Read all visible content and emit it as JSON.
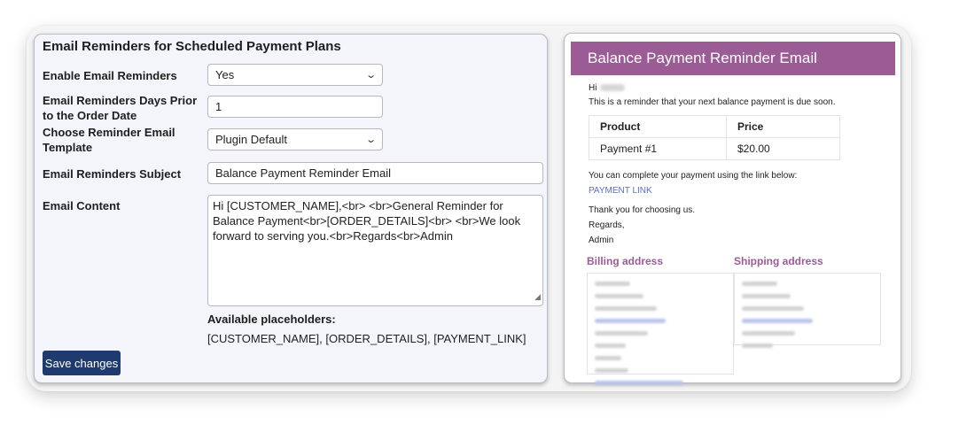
{
  "settings": {
    "title": "Email Reminders for Scheduled Payment Plans",
    "fields": [
      {
        "label": "Enable Email Reminders",
        "value": "Yes"
      },
      {
        "label": "Email Reminders Days Prior to the Order Date",
        "value": "1"
      },
      {
        "label": "Choose Reminder Email Template",
        "value": "Plugin Default"
      },
      {
        "label": "Email Reminders Subject",
        "value": "Balance Payment Reminder Email"
      },
      {
        "label": "Email Content",
        "value": "Hi [CUSTOMER_NAME],<br> <br>General Reminder for Balance Payment<br>[ORDER_DETAILS]<br> <br>We look forward to serving you.<br>Regards<br>Admin"
      }
    ],
    "placeholders_title": "Available placeholders:",
    "placeholders_list": "[CUSTOMER_NAME], [ORDER_DETAILS], [PAYMENT_LINK]",
    "save_label": "Save changes"
  },
  "preview": {
    "header": "Balance Payment Reminder Email",
    "greeting": "Hi",
    "intro": "This is a reminder that your next balance payment is due soon.",
    "table": {
      "headers": [
        "Product",
        "Price"
      ],
      "rows": [
        [
          "Payment #1",
          "$20.00"
        ]
      ]
    },
    "complete_text": "You can complete your payment using the link below:",
    "payment_link": "PAYMENT LINK",
    "thanks": "Thank you for choosing us.",
    "regards": "Regards,",
    "signature": "Admin",
    "billing_title": "Billing address",
    "shipping_title": "Shipping address"
  },
  "colors": {
    "accent": "#9b5b95",
    "button": "#1f3a6e",
    "link": "#5b6dc7"
  }
}
